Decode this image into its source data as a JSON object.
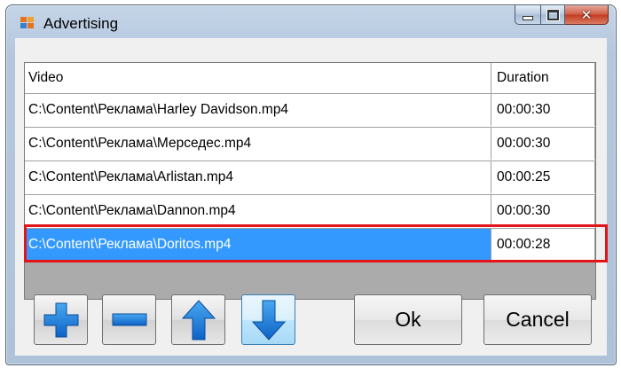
{
  "window": {
    "title": "Advertising",
    "accent_color": "#3399ff",
    "highlight_color": "#e3151a"
  },
  "grid": {
    "columns": [
      "Video",
      "Duration"
    ],
    "rows": [
      {
        "video": "C:\\Content\\Реклама\\Harley Davidson.mp4",
        "duration": "00:00:30"
      },
      {
        "video": "C:\\Content\\Реклама\\Мерседес.mp4",
        "duration": "00:00:30"
      },
      {
        "video": "C:\\Content\\Реклама\\Arlistan.mp4",
        "duration": "00:00:25"
      },
      {
        "video": "C:\\Content\\Реклама\\Dannon.mp4",
        "duration": "00:00:30"
      },
      {
        "video": "C:\\Content\\Реклама\\Doritos.mp4",
        "duration": "00:00:28"
      }
    ],
    "selected_index": 4
  },
  "toolbar": {
    "icons": [
      "plus-icon",
      "minus-icon",
      "arrow-up-icon",
      "arrow-down-icon"
    ]
  },
  "buttons": {
    "ok_label": "Ok",
    "cancel_label": "Cancel"
  }
}
